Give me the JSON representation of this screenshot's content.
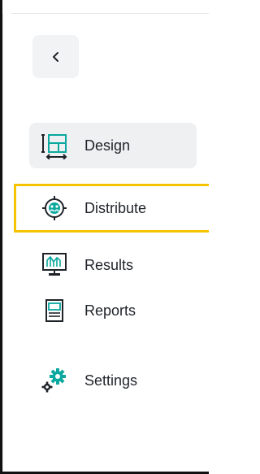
{
  "sidebar": {
    "back_icon": "chevron-left-icon",
    "items": [
      {
        "label": "Design",
        "icon": "design-icon",
        "state": "selected"
      },
      {
        "label": "Distribute",
        "icon": "distribute-icon",
        "state": "highlighted"
      },
      {
        "label": "Results",
        "icon": "results-icon"
      },
      {
        "label": "Reports",
        "icon": "reports-icon"
      },
      {
        "label": "Settings",
        "icon": "settings-icon"
      }
    ]
  },
  "colors": {
    "highlight_border": "#f5c400",
    "selected_background": "#eef0f2",
    "accent_teal": "#0aa89e"
  }
}
